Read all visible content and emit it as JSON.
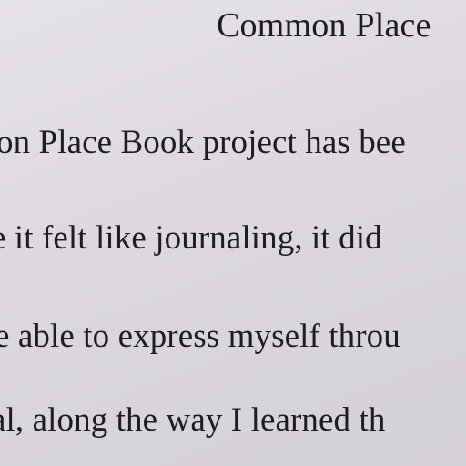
{
  "document": {
    "title": "Common Place",
    "lines": [
      "on Place Book project has bee",
      "e it felt like journaling, it did",
      "e able to express myself throu",
      "al, along the way I learned th"
    ]
  }
}
